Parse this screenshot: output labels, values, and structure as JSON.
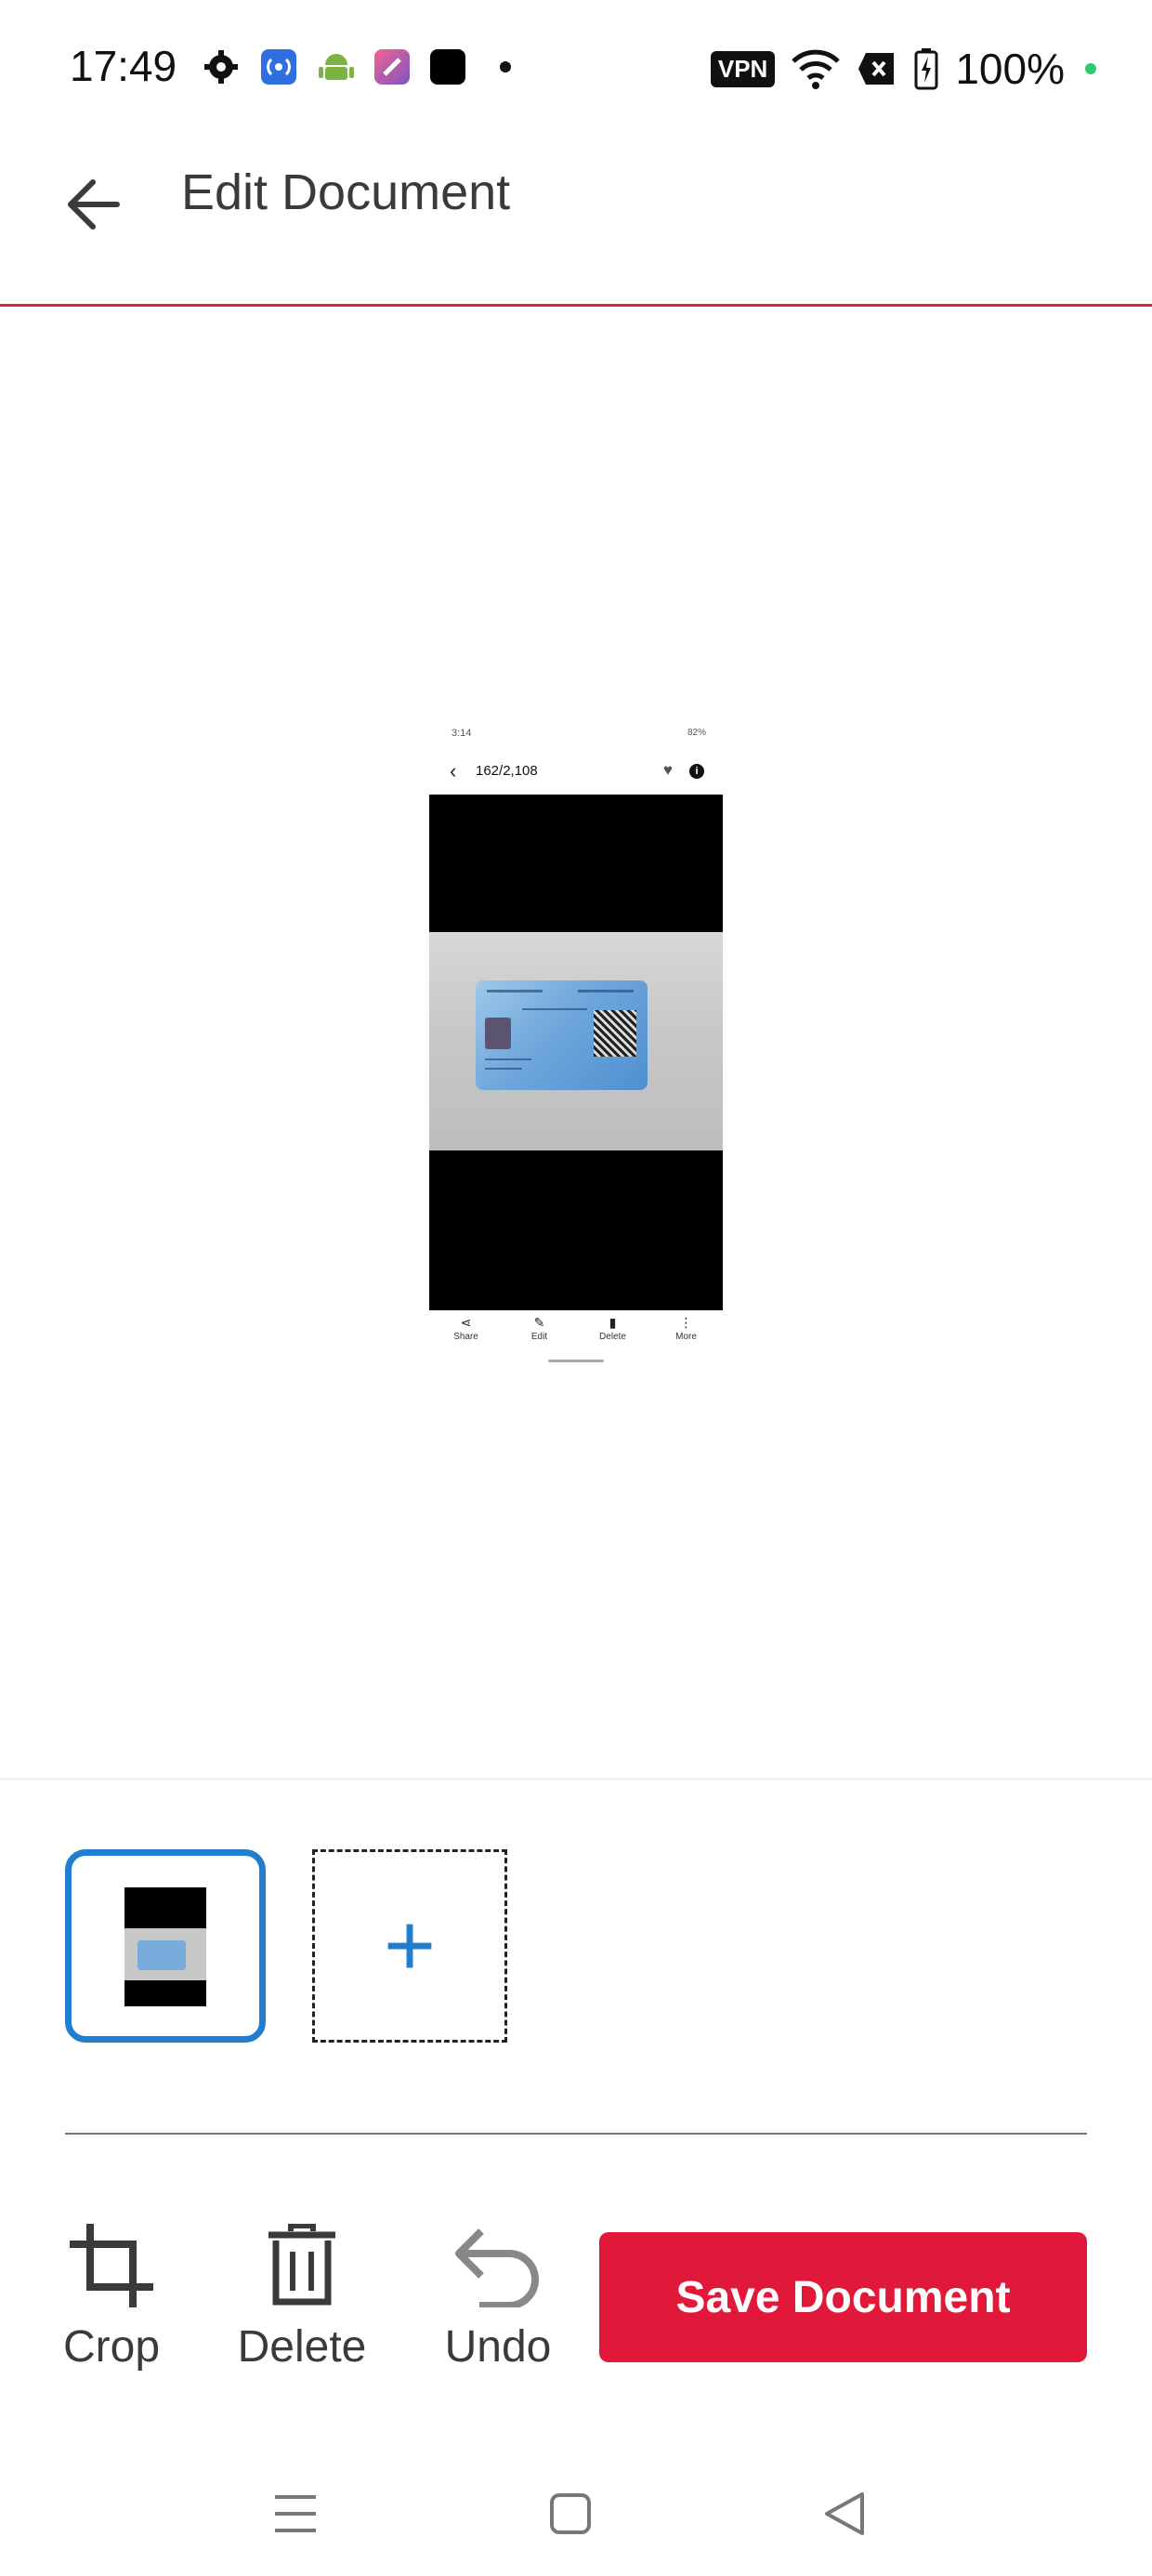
{
  "status_bar": {
    "time": "17:49",
    "vpn": "VPN",
    "battery": "100%",
    "icons": [
      "settings-icon",
      "radio-icon",
      "android-icon",
      "app-icon",
      "square-app-icon",
      "dot-icon",
      "wifi-icon",
      "x-badge-icon",
      "battery-icon"
    ]
  },
  "app_bar": {
    "title": "Edit Document",
    "back_icon": "arrow-left-icon"
  },
  "document_preview": {
    "status_time": "3:14",
    "status_right": "82%",
    "page_counter": "162/2,108",
    "toolbar": [
      {
        "icon": "share-icon",
        "label": "Share"
      },
      {
        "icon": "edit-icon",
        "label": "Edit"
      },
      {
        "icon": "delete-icon",
        "label": "Delete"
      },
      {
        "icon": "more-icon",
        "label": "More"
      }
    ]
  },
  "pages_strip": {
    "add_label": "+",
    "selected_color": "#1f7ed0"
  },
  "bottom_actions": {
    "crop": "Crop",
    "delete": "Delete",
    "undo": "Undo",
    "save": "Save Document"
  },
  "colors": {
    "accent": "#e2183a",
    "selected": "#1f7ed0"
  }
}
